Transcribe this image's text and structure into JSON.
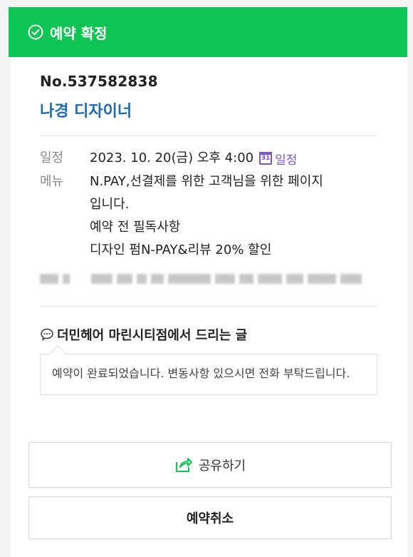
{
  "banner": {
    "status": "예약 확정",
    "icon": "check-circle-icon"
  },
  "booking": {
    "number": "No.537582838",
    "designer": "나경 디자이너",
    "schedule_label": "일정",
    "schedule_value": "2023. 10. 20(금) 오후 4:00",
    "calendar_link": "일정",
    "calendar_day": "31",
    "menu_label": "메뉴",
    "menu_lines": [
      "N.PAY,선결제를 위한 고객님을 위한 페이지",
      "입니다.",
      "예약 전 필독사항",
      "디자인 펌N-PAY&리뷰 20% 할인"
    ]
  },
  "message": {
    "title": "더민헤어 마린시티점에서 드리는 글",
    "body": "예약이 완료되었습니다. 변동사항 있으시면 전화 부탁드립니다."
  },
  "actions": {
    "share": "공유하기",
    "cancel": "예약취소"
  },
  "colors": {
    "accent_green": "#0ec553",
    "designer_blue": "#1e6bb0",
    "calendar_purple": "#7b54c9"
  }
}
